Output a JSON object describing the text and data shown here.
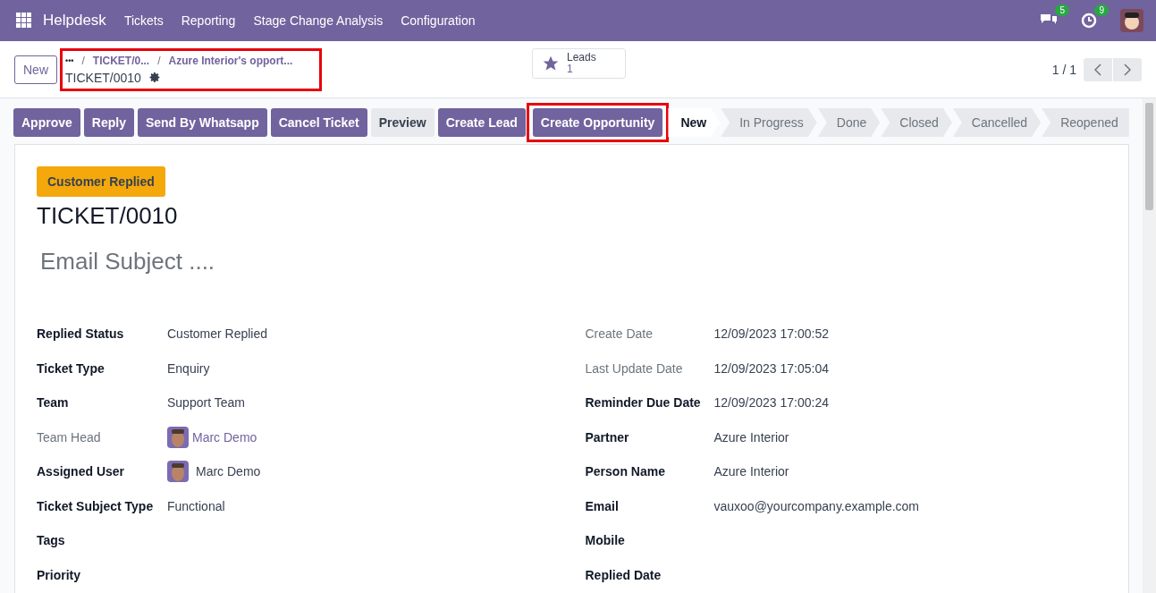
{
  "navbar": {
    "app": "Helpdesk",
    "menu": [
      "Tickets",
      "Reporting",
      "Stage Change Analysis",
      "Configuration"
    ],
    "messages_badge": "5",
    "activities_badge": "9"
  },
  "control_panel": {
    "new_button": "New",
    "breadcrumb": {
      "highlighted": true,
      "ellipsis": "•••",
      "items": [
        {
          "separator": "/",
          "label": "TICKET/0..."
        },
        {
          "separator": "/",
          "label": "Azure Interior's opport..."
        }
      ],
      "current": "TICKET/0010"
    },
    "smart_button": {
      "label": "Leads",
      "count": "1"
    },
    "pager": "1 / 1"
  },
  "actions": [
    {
      "label": "Approve",
      "kind": "primary",
      "highlighted": false
    },
    {
      "label": "Reply",
      "kind": "primary",
      "highlighted": false
    },
    {
      "label": "Send By Whatsapp",
      "kind": "primary",
      "highlighted": false
    },
    {
      "label": "Cancel Ticket",
      "kind": "primary",
      "highlighted": false
    },
    {
      "label": "Preview",
      "kind": "secondary",
      "highlighted": false
    },
    {
      "label": "Create Lead",
      "kind": "primary",
      "highlighted": false
    },
    {
      "label": "Create Opportunity",
      "kind": "primary",
      "highlighted": true
    }
  ],
  "stages": [
    {
      "label": "New",
      "selected": true
    },
    {
      "label": "In Progress",
      "selected": false
    },
    {
      "label": "Done",
      "selected": false
    },
    {
      "label": "Closed",
      "selected": false
    },
    {
      "label": "Cancelled",
      "selected": false
    },
    {
      "label": "Reopened",
      "selected": false
    }
  ],
  "form": {
    "status_badge": "Customer Replied",
    "title": "TICKET/0010",
    "subject_placeholder": "Email Subject ....",
    "left_fields": [
      {
        "label": "Replied Status",
        "value": "Customer Replied",
        "kind": "text",
        "muted": false
      },
      {
        "label": "Ticket Type",
        "value": "Enquiry",
        "kind": "text",
        "muted": false
      },
      {
        "label": "Team",
        "value": "Support Team",
        "kind": "text",
        "muted": false
      },
      {
        "label": "Team Head",
        "value": "Marc Demo",
        "kind": "avatar_link",
        "muted": true
      },
      {
        "label": "Assigned User",
        "value": "Marc Demo",
        "kind": "avatar",
        "muted": false
      },
      {
        "label": "Ticket Subject Type",
        "value": "Functional",
        "kind": "text",
        "muted": false
      },
      {
        "label": "Tags",
        "muted": false
      },
      {
        "label": "Priority",
        "muted": false
      }
    ],
    "right_fields": [
      {
        "label": "Create Date",
        "value": "12/09/2023 17:00:52",
        "kind": "text",
        "muted": true
      },
      {
        "label": "Last Update Date",
        "value": "12/09/2023 17:05:04",
        "kind": "text",
        "muted": true
      },
      {
        "label": "Reminder Due Date",
        "value": "12/09/2023 17:00:24",
        "kind": "text",
        "muted": false
      },
      {
        "label": "Partner",
        "value": "Azure Interior",
        "kind": "text",
        "muted": false
      },
      {
        "label": "Person Name",
        "value": "Azure Interior",
        "kind": "text",
        "muted": false
      },
      {
        "label": "Email",
        "value": "vauxoo@yourcompany.example.com",
        "kind": "text",
        "muted": false
      },
      {
        "label": "Mobile",
        "muted": false
      },
      {
        "label": "Replied Date",
        "muted": false
      }
    ]
  }
}
